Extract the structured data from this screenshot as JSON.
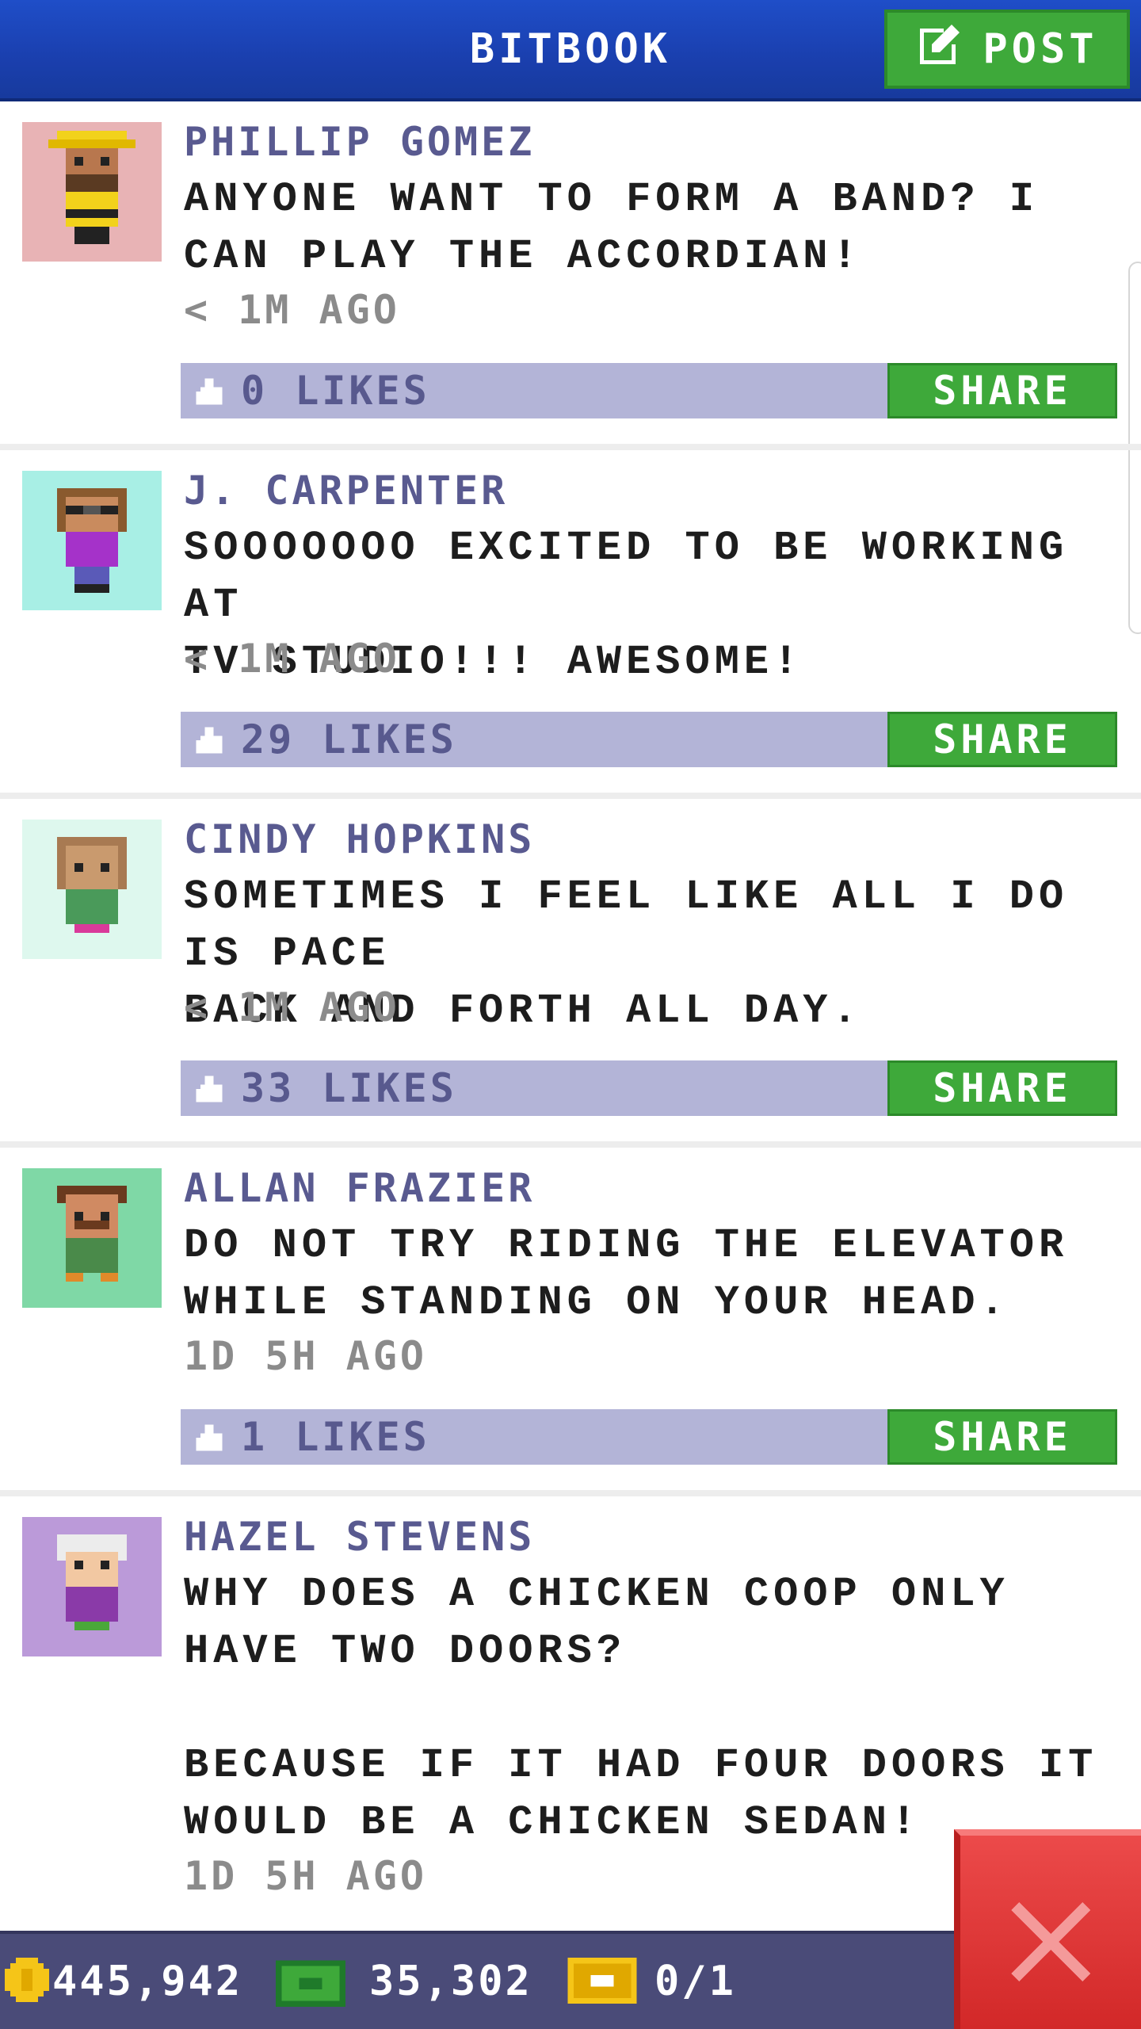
{
  "header": {
    "title": "BITBOOK",
    "post_label": "POST"
  },
  "posts": [
    {
      "name": "PHILLIP GOMEZ",
      "message": "ANYONE WANT TO FORM A BAND? I\nCAN PLAY THE ACCORDIAN!",
      "time": "< 1M AGO",
      "likes": "0 LIKES",
      "share_label": "SHARE",
      "avatar_bg": "#e8b3b5"
    },
    {
      "name": "J. CARPENTER",
      "message": "SOOOOOOO EXCITED TO BE WORKING AT\nTV STUDIO!!! AWESOME!",
      "time": "< 1M AGO",
      "likes": "29 LIKES",
      "share_label": "SHARE",
      "avatar_bg": "#a8efe5"
    },
    {
      "name": "CINDY HOPKINS",
      "message": "SOMETIMES I FEEL LIKE ALL I DO IS PACE\nBACK AND FORTH ALL DAY.",
      "time": "< 1M AGO",
      "likes": "33 LIKES",
      "share_label": "SHARE",
      "avatar_bg": "#def8ee"
    },
    {
      "name": "ALLAN FRAZIER",
      "message": "DO NOT TRY RIDING THE ELEVATOR\nWHILE STANDING ON YOUR HEAD.",
      "time": "1D 5H AGO",
      "likes": "1 LIKES",
      "share_label": "SHARE",
      "avatar_bg": "#7fd8a6"
    },
    {
      "name": "HAZEL STEVENS",
      "message": "WHY DOES A CHICKEN COOP ONLY\nHAVE TWO DOORS?\n\nBECAUSE IF IT HAD FOUR DOORS IT\nWOULD BE A CHICKEN SEDAN!",
      "time": "1D 5H AGO",
      "likes": "",
      "share_label": "",
      "avatar_bg": "#bb9ad9"
    }
  ],
  "footer": {
    "coins": "445,942",
    "bux": "35,302",
    "tickets": "0/1"
  },
  "icons": {
    "post": "edit-icon",
    "like": "thumbs-up-icon",
    "coins": "coin-icon",
    "bux": "cash-icon",
    "tickets": "ticket-icon",
    "close": "close-icon"
  },
  "colors": {
    "header_blue": "#1a3fae",
    "share_green": "#3ea93a",
    "like_bar": "#b3b4d7",
    "name_purple": "#595a90",
    "footer": "#4a4b78",
    "close_red": "#d22828"
  }
}
